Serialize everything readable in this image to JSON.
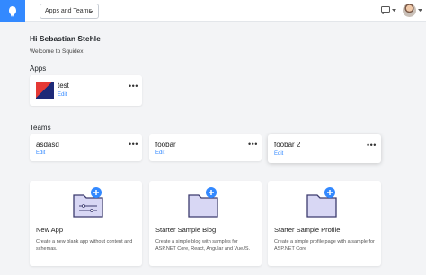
{
  "topbar": {
    "apps_button_label": "Apps and Teams",
    "logo_icon": "squidex-logo-icon",
    "accent_color": "#3389ff"
  },
  "greeting": {
    "title": "Hi Sebastian Stehle",
    "subtitle": "Welcome to Squidex."
  },
  "sections": {
    "apps_label": "Apps",
    "teams_label": "Teams"
  },
  "apps": [
    {
      "name": "test",
      "edit_label": "Edit",
      "menu": "•••"
    }
  ],
  "teams": [
    {
      "name": "asdasd",
      "edit_label": "Edit",
      "menu": "•••"
    },
    {
      "name": "foobar",
      "edit_label": "Edit",
      "menu": "•••"
    },
    {
      "name": "foobar 2",
      "edit_label": "Edit",
      "menu": "•••"
    }
  ],
  "templates": [
    {
      "title": "New App",
      "description": "Create a new blank app without content and schemas."
    },
    {
      "title": "Starter Sample Blog",
      "description": "Create a simple blog with samples for ASP.NET Core, React, Angular and VueJS."
    },
    {
      "title": "Starter Sample Profile",
      "description": "Create a simple profile page with a sample for ASP.NET Core"
    }
  ]
}
